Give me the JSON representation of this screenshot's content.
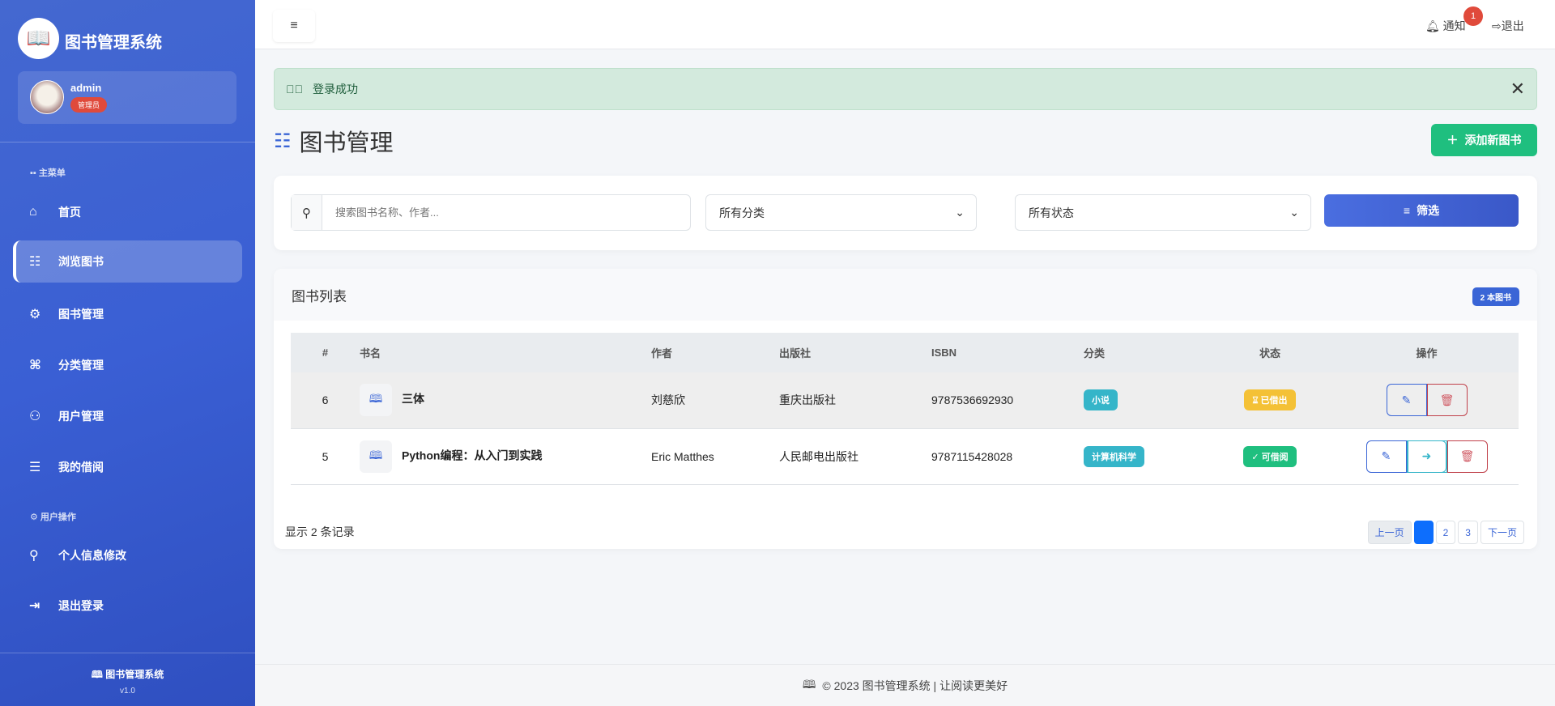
{
  "sidebar": {
    "brand": "图书管理系统",
    "user": {
      "name": "admin",
      "role": "管理员"
    },
    "section_main": "主菜单",
    "section_user": "用户操作",
    "items": [
      {
        "label": "首页",
        "icon": "⌂"
      },
      {
        "label": "浏览图书",
        "icon": "☷"
      },
      {
        "label": "图书管理",
        "icon": "⚙"
      },
      {
        "label": "分类管理",
        "icon": "⌘"
      },
      {
        "label": "用户管理",
        "icon": "⚇"
      },
      {
        "label": "我的借阅",
        "icon": "☰"
      }
    ],
    "user_items": [
      {
        "label": "个人信息修改",
        "icon": "⚲"
      },
      {
        "label": "退出登录",
        "icon": "⇥"
      }
    ],
    "footer_title": "图书管理系统",
    "version": "v1.0"
  },
  "header": {
    "notify": "通知",
    "notify_count": "1",
    "logout": "退出"
  },
  "alert": {
    "text": "登录成功"
  },
  "page": {
    "title": "图书管理",
    "add_button": "添加新图书"
  },
  "filters": {
    "search_placeholder": "搜索图书名称、作者...",
    "category": "所有分类",
    "status": "所有状态",
    "filter_button": "筛选"
  },
  "list": {
    "title": "图书列表",
    "count": "2 本图书",
    "columns": [
      "#",
      "书名",
      "作者",
      "出版社",
      "ISBN",
      "分类",
      "状态",
      "操作"
    ],
    "rows": [
      {
        "id": "6",
        "title": "三体",
        "author": "刘慈欣",
        "publisher": "重庆出版社",
        "isbn": "9787536692930",
        "category": "小说",
        "status": "已借出"
      },
      {
        "id": "5",
        "title": "Python编程：从入门到实践",
        "author": "Eric Matthes",
        "publisher": "人民邮电出版社",
        "isbn": "9787115428028",
        "category": "计算机科学",
        "status": "可借阅"
      }
    ],
    "shown": "显示 2 条记录",
    "pager": {
      "prev": "上一页",
      "pages": [
        "2",
        "3"
      ],
      "next": "下一页"
    }
  },
  "footer": {
    "text": "© 2023 图书管理系统 | 让阅读更美好"
  },
  "colors": {
    "primary": "#3a65d6",
    "success": "#1fbf7f",
    "danger": "#e04a3b",
    "info": "#35b5c9",
    "warning": "#f4c136"
  }
}
